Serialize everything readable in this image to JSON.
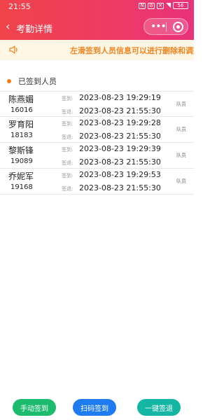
{
  "status_bar": {
    "time": "21:55",
    "battery": "56",
    "icons": [
      "nfc-icon",
      "mute-icon",
      "no-sim-icon",
      "wifi-icon",
      "battery-icon"
    ]
  },
  "nav": {
    "back": "‹",
    "title": "考勤详情"
  },
  "notice": {
    "text": "左滑签到人员信息可以进行删除和调整"
  },
  "section": {
    "title": "已签到人员"
  },
  "labels": {
    "sign_in": "签到:",
    "sign_out": "签退:"
  },
  "people": [
    {
      "name": "陈燕媚",
      "id": "16016",
      "sign_in": "2023-08-23 19:29:19",
      "sign_out": "2023-08-23 21:55:30",
      "role": "队员"
    },
    {
      "name": "罗育阳",
      "id": "18183",
      "sign_in": "2023-08-23 19:29:28",
      "sign_out": "2023-08-23 21:55:30",
      "role": "队员"
    },
    {
      "name": "黎斯锋",
      "id": "19089",
      "sign_in": "2023-08-23 19:29:39",
      "sign_out": "2023-08-23 21:55:30",
      "role": "队员"
    },
    {
      "name": "乔妮军",
      "id": "19168",
      "sign_in": "2023-08-23 19:29:53",
      "sign_out": "2023-08-23 21:55:30",
      "role": "队员"
    }
  ],
  "buttons": {
    "manual": "手动签到",
    "scan": "扫码签到",
    "one_click_out": "一键签退"
  },
  "colors": {
    "header_start": "#f0444a",
    "header_end": "#e8327a",
    "notice_text": "#f0841f",
    "manual": "#1dbb6d",
    "scan": "#1f7cf0",
    "sign_out_all": "#15b6a4"
  }
}
